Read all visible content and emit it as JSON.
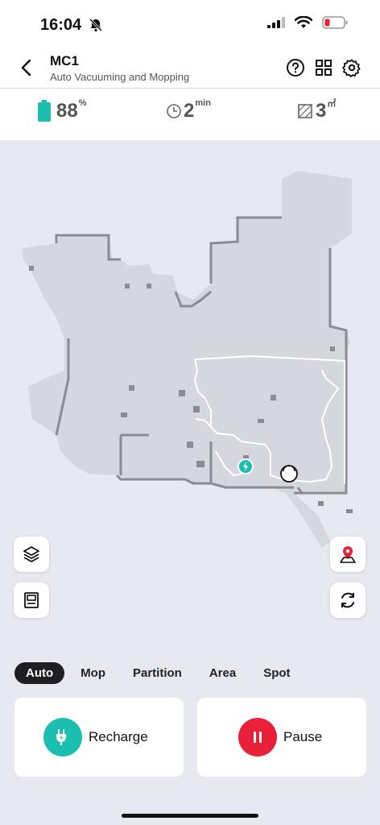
{
  "status": {
    "time": "16:04"
  },
  "header": {
    "title": "MC1",
    "subtitle": "Auto Vacuuming and Mopping"
  },
  "stats": {
    "battery": {
      "value": "88",
      "unit": "%",
      "level": 0.88
    },
    "time": {
      "value": "2",
      "unit": "min"
    },
    "area": {
      "value": "3",
      "unit": "㎡"
    }
  },
  "modes": [
    "Auto",
    "Mop",
    "Partition",
    "Area",
    "Spot"
  ],
  "active_mode": "Auto",
  "actions": {
    "recharge": {
      "label": "Recharge",
      "color": "#1bbfb0"
    },
    "pause": {
      "label": "Pause",
      "color": "#e8203a"
    }
  },
  "icons": {
    "back": "chevron-left-icon",
    "help": "question-icon",
    "grid": "grid-icon",
    "settings": "gear-icon",
    "layers": "layers-icon",
    "cabinet": "cabinet-icon",
    "location": "map-pin-icon",
    "rotate": "rotate-icon"
  },
  "colors": {
    "accent": "#1bbfb0",
    "danger": "#e8203a",
    "battery": "#1bbfb0"
  }
}
